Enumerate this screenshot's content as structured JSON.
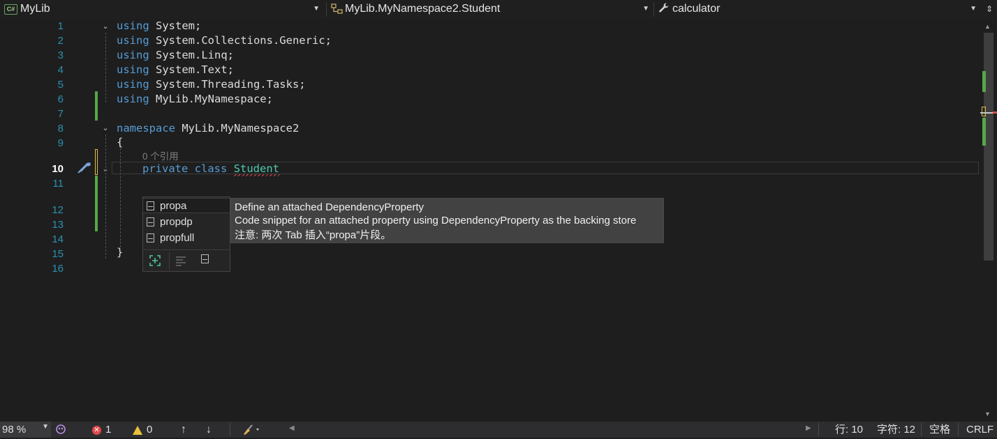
{
  "navbar": {
    "project": {
      "icon": "csharp-project-icon",
      "icon_text": "C#",
      "label": "MyLib"
    },
    "class": {
      "icon": "class-icon",
      "label": "MyLib.MyNamespace2.Student"
    },
    "member": {
      "icon": "wrench-icon",
      "label": "calculator"
    }
  },
  "editor": {
    "line_numbers": [
      "1",
      "2",
      "3",
      "4",
      "5",
      "6",
      "7",
      "8",
      "9",
      "10",
      "11",
      "12",
      "13",
      "14",
      "15",
      "16"
    ],
    "active_line": "10",
    "lines": {
      "l1": {
        "kw": "using",
        "rest": " System;"
      },
      "l2": {
        "kw": "using",
        "rest": " System.Collections.Generic;"
      },
      "l3": {
        "kw": "using",
        "rest": " System.Linq;"
      },
      "l4": {
        "kw": "using",
        "rest": " System.Text;"
      },
      "l5": {
        "kw": "using",
        "rest": " System.Threading.Tasks;"
      },
      "l6": {
        "kw": "using",
        "rest": " MyLib.MyNamespace;"
      },
      "l8": {
        "kw": "namespace",
        "rest": " MyLib.MyNamespace2"
      },
      "l9": {
        "text": "{"
      },
      "l10": {
        "kw1": "private",
        "kw2": "class",
        "type": "Student"
      },
      "l15": {
        "text": "}"
      }
    },
    "codelens": "0 个引用"
  },
  "completion": {
    "items": [
      {
        "label": "propa",
        "selected": true
      },
      {
        "label": "propdp",
        "selected": false
      },
      {
        "label": "propfull",
        "selected": false
      }
    ],
    "filters": [
      "expand-filter-icon",
      "list-filter-icon",
      "snippet-filter-icon"
    ]
  },
  "tooltip": {
    "title": "Define an attached DependencyProperty",
    "description": "Code snippet for an attached property using DependencyProperty as the backing store",
    "note": "注意: 两次 Tab 插入“propa”片段。"
  },
  "statusbar": {
    "zoom": "98 %",
    "errors": "1",
    "warnings": "0",
    "line": "行: 10",
    "column": "字符: 12",
    "whitespace": "空格",
    "line_ending": "CRLF"
  },
  "colors": {
    "keyword": "#569cd6",
    "type": "#4ec9b0",
    "line_number": "#2b91af",
    "change_saved": "#57a64a",
    "change_unsaved": "#e0c04a",
    "error": "#e04a4a"
  }
}
